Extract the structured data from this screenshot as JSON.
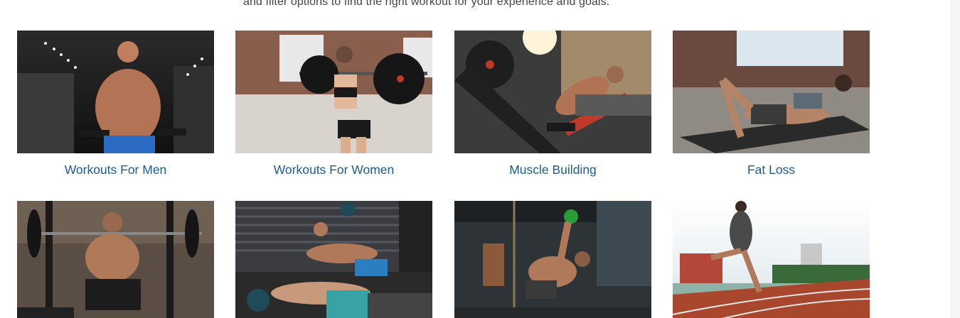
{
  "intro": {
    "text": "and filter options to find the right workout for your experience and goals."
  },
  "categories": [
    {
      "label": "Workouts For Men"
    },
    {
      "label": "Workouts For Women"
    },
    {
      "label": "Muscle Building"
    },
    {
      "label": "Fat Loss"
    },
    {
      "label": ""
    },
    {
      "label": ""
    },
    {
      "label": ""
    },
    {
      "label": ""
    }
  ]
}
